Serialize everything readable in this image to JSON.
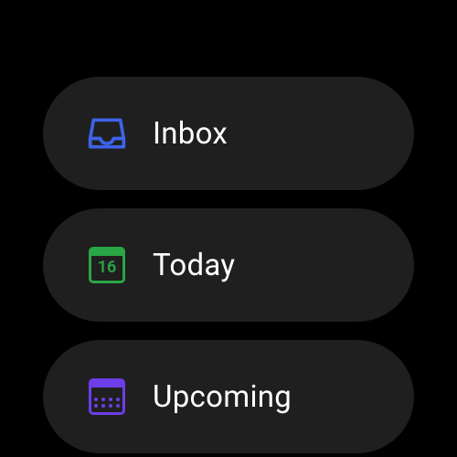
{
  "menu": {
    "items": [
      {
        "label": "Inbox"
      },
      {
        "label": "Today",
        "day": "16"
      },
      {
        "label": "Upcoming"
      }
    ]
  }
}
